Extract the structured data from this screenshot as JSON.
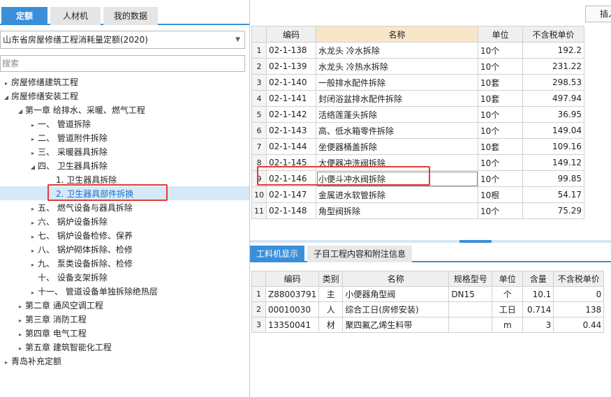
{
  "tabs": [
    "定额",
    "人材机",
    "我的数据"
  ],
  "insert_label": "插入",
  "dropdown": {
    "value": "山东省房屋修缮工程消耗量定额(2020)"
  },
  "search": {
    "placeholder": "搜索"
  },
  "tree": [
    {
      "label": "房屋修缮建筑工程",
      "toggle": "▸"
    },
    {
      "label": "房屋修缮安装工程",
      "toggle": "◢"
    },
    {
      "label": "第一章 给排水、采暖、燃气工程",
      "toggle": "◢"
    },
    {
      "label": "一、  管道拆除",
      "toggle": "▸"
    },
    {
      "label": "二、  管道附件拆除",
      "toggle": "▸"
    },
    {
      "label": "三、  采暖器具拆除",
      "toggle": "▸"
    },
    {
      "label": "四、  卫生器具拆除",
      "toggle": "◢"
    },
    {
      "label": "1. 卫生器具拆除",
      "toggle": ""
    },
    {
      "label": "2. 卫生器具部件拆换",
      "toggle": ""
    },
    {
      "label": "五、  燃气设备与器具拆除",
      "toggle": "▸"
    },
    {
      "label": "六、  锅炉设备拆除",
      "toggle": "▸"
    },
    {
      "label": "七、  锅炉设备检修、保养",
      "toggle": "▸"
    },
    {
      "label": "八、  锅炉砌体拆除、检修",
      "toggle": "▸"
    },
    {
      "label": "九、  泵类设备拆除、检修",
      "toggle": "▸"
    },
    {
      "label": "十、  设备支架拆除",
      "toggle": ""
    },
    {
      "label": "十一、 管道设备单独拆除绝热层",
      "toggle": "▸"
    },
    {
      "label": "第二章 通风空调工程",
      "toggle": "▸"
    },
    {
      "label": "第三章 消防工程",
      "toggle": "▸"
    },
    {
      "label": "第四章 电气工程",
      "toggle": "▸"
    },
    {
      "label": "第五章 建筑智能化工程",
      "toggle": "▸"
    },
    {
      "label": "青岛补充定额",
      "toggle": "▸"
    }
  ],
  "quota_table": {
    "headers": [
      "",
      "编码",
      "名称",
      "单位",
      "不含税单价"
    ],
    "rows": [
      [
        "1",
        "02-1-138",
        "水龙头 冷水拆除",
        "10个",
        "192.2"
      ],
      [
        "2",
        "02-1-139",
        "水龙头 冷热水拆除",
        "10个",
        "231.22"
      ],
      [
        "3",
        "02-1-140",
        "一般排水配件拆除",
        "10套",
        "298.53"
      ],
      [
        "4",
        "02-1-141",
        "封闭浴盆排水配件拆除",
        "10套",
        "497.94"
      ],
      [
        "5",
        "02-1-142",
        "活络莲蓬头拆除",
        "10个",
        "36.95"
      ],
      [
        "6",
        "02-1-143",
        "高、低水箱零件拆除",
        "10个",
        "149.04"
      ],
      [
        "7",
        "02-1-144",
        "坐便器桶盖拆除",
        "10套",
        "109.16"
      ],
      [
        "8",
        "02-1-145",
        "大便器冲洗阀拆除",
        "10个",
        "149.12"
      ],
      [
        "9",
        "02-1-146",
        "小便斗冲水阀拆除",
        "10个",
        "99.85"
      ],
      [
        "10",
        "02-1-147",
        "金属进水软管拆除",
        "10根",
        "54.17"
      ],
      [
        "11",
        "02-1-148",
        "角型阀拆除",
        "10个",
        "75.29"
      ]
    ]
  },
  "bottom_tabs": [
    "工料机显示",
    "子目工程内容和附注信息"
  ],
  "resource_table": {
    "headers": [
      "",
      "编码",
      "类别",
      "名称",
      "规格型号",
      "单位",
      "含量",
      "不含税单价"
    ],
    "rows": [
      [
        "1",
        "Z88003791",
        "主",
        "小便器角型阀",
        "DN15",
        "个",
        "10.1",
        "0"
      ],
      [
        "2",
        "00010030",
        "人",
        "综合工日(房修安装)",
        "",
        "工日",
        "0.714",
        "138"
      ],
      [
        "3",
        "13350041",
        "材",
        "聚四氟乙烯生料带",
        "",
        "m",
        "3",
        "0.44"
      ]
    ]
  }
}
